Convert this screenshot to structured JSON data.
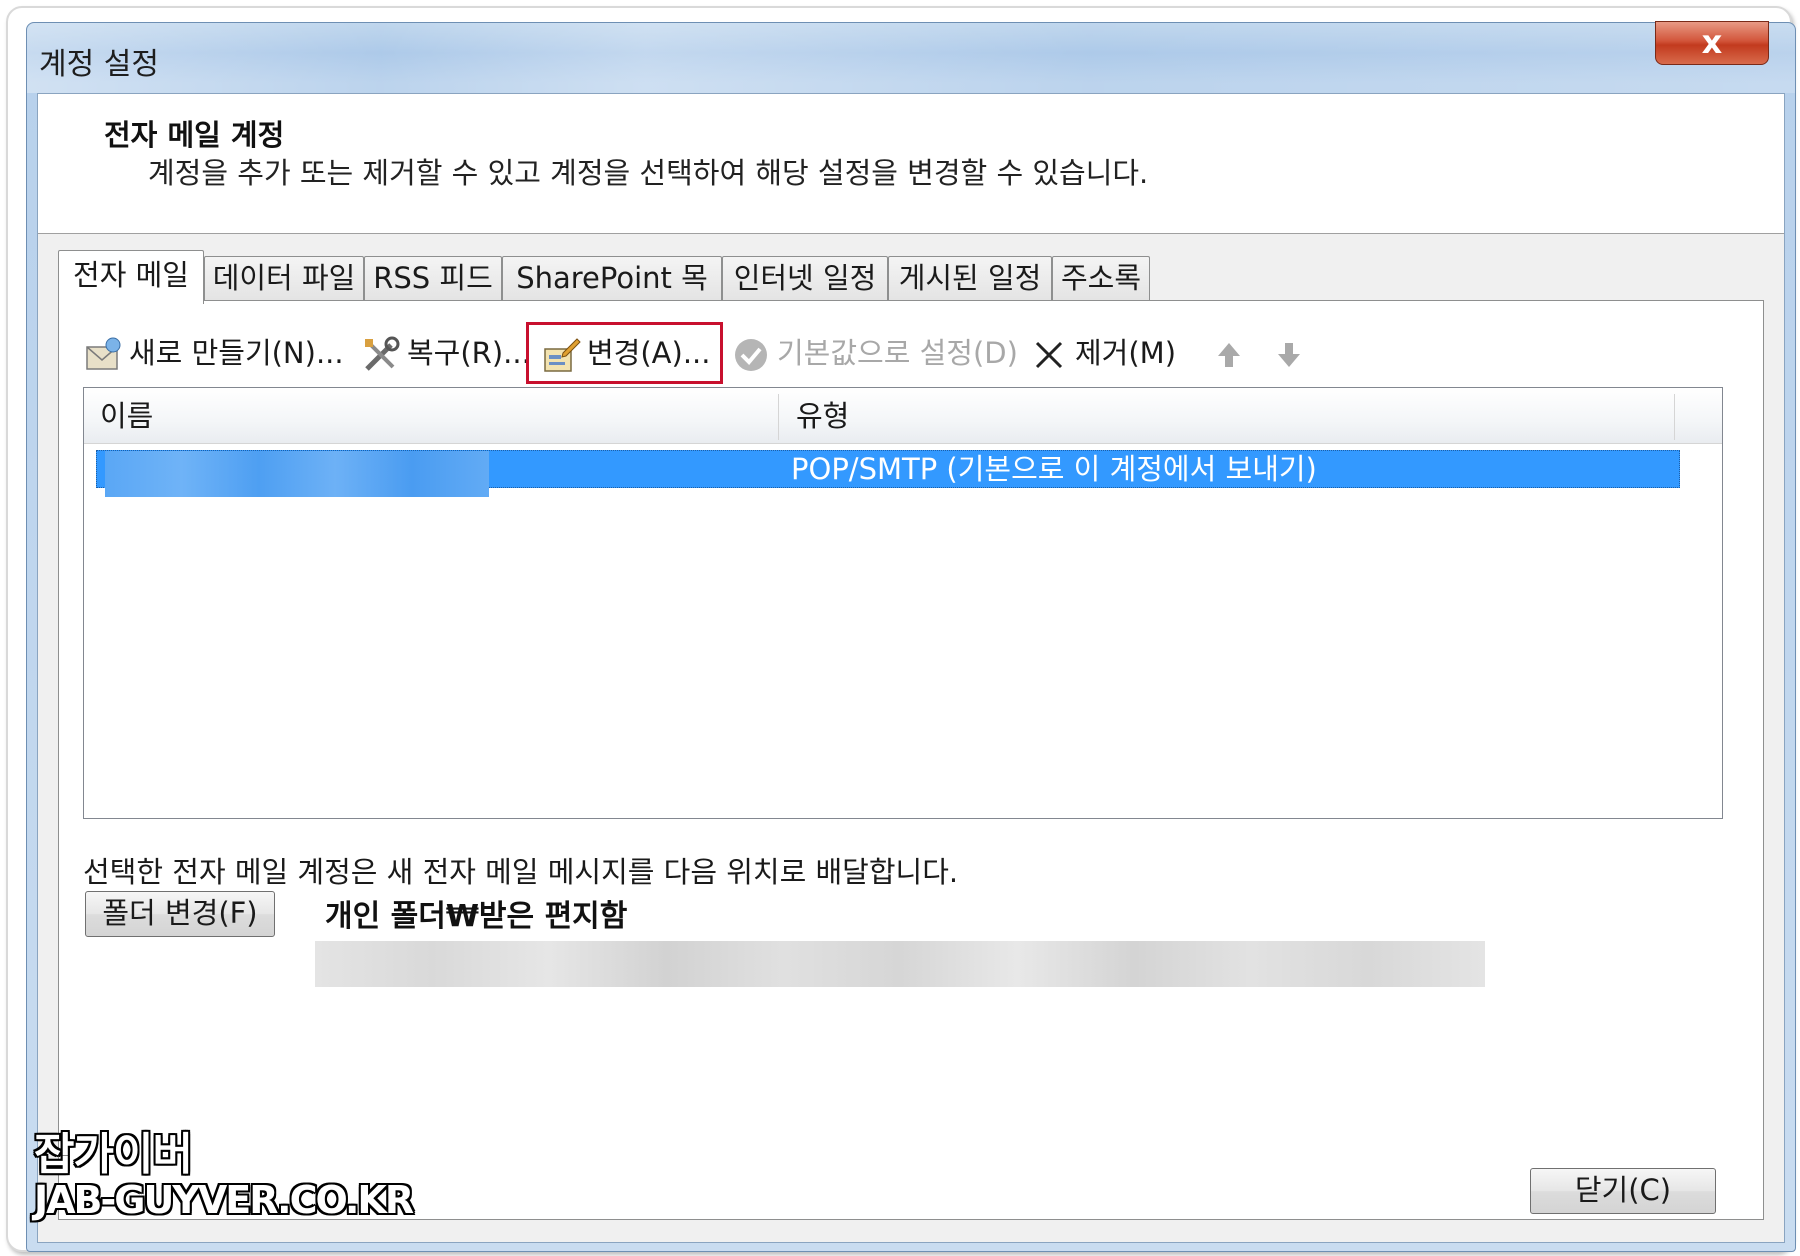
{
  "window": {
    "title": "계정 설정",
    "close_glyph": "x"
  },
  "header": {
    "title": "전자 메일 계정",
    "description": "계정을 추가 또는 제거할 수 있고 계정을 선택하여 해당 설정을 변경할 수 있습니다."
  },
  "tabs": [
    {
      "label": "전자 메일",
      "active": true
    },
    {
      "label": "데이터 파일",
      "active": false
    },
    {
      "label": "RSS 피드",
      "active": false
    },
    {
      "label": "SharePoint 목록",
      "active": false
    },
    {
      "label": "인터넷 일정",
      "active": false
    },
    {
      "label": "게시된 일정",
      "active": false
    },
    {
      "label": "주소록",
      "active": false
    }
  ],
  "toolbar": {
    "new": {
      "label": "새로 만들기(N)...",
      "icon": "new-account-icon"
    },
    "repair": {
      "label": "복구(R)...",
      "icon": "repair-tools-icon"
    },
    "change": {
      "label": "변경(A)...",
      "icon": "change-account-icon",
      "highlighted": true
    },
    "set_default": {
      "label": "기본값으로 설정(D)",
      "icon": "checkmark-circle-icon",
      "disabled": true
    },
    "remove": {
      "label": "제거(M)",
      "icon": "remove-x-icon"
    },
    "move_up_icon": "arrow-up-icon",
    "move_down_icon": "arrow-down-icon"
  },
  "list": {
    "columns": [
      "이름",
      "유형"
    ],
    "rows": [
      {
        "name": "",
        "type": "POP/SMTP (기본으로 이 계정에서 보내기)",
        "selected": true
      }
    ]
  },
  "delivery": {
    "text": "선택한 전자 메일 계정은 새 전자 메일 메시지를 다음 위치로 배달합니다.",
    "change_folder_label": "폴더 변경(F)",
    "folder_path": "개인 폴더₩받은 편지함"
  },
  "footer": {
    "close_label": "닫기(C)"
  },
  "watermark": {
    "line1": "잡가이버",
    "line2": "JAB-GUYVER.CO.KR"
  },
  "colors": {
    "selection": "#3399ff",
    "highlight_border": "#c8102e",
    "close_button": "#c23a1e"
  }
}
